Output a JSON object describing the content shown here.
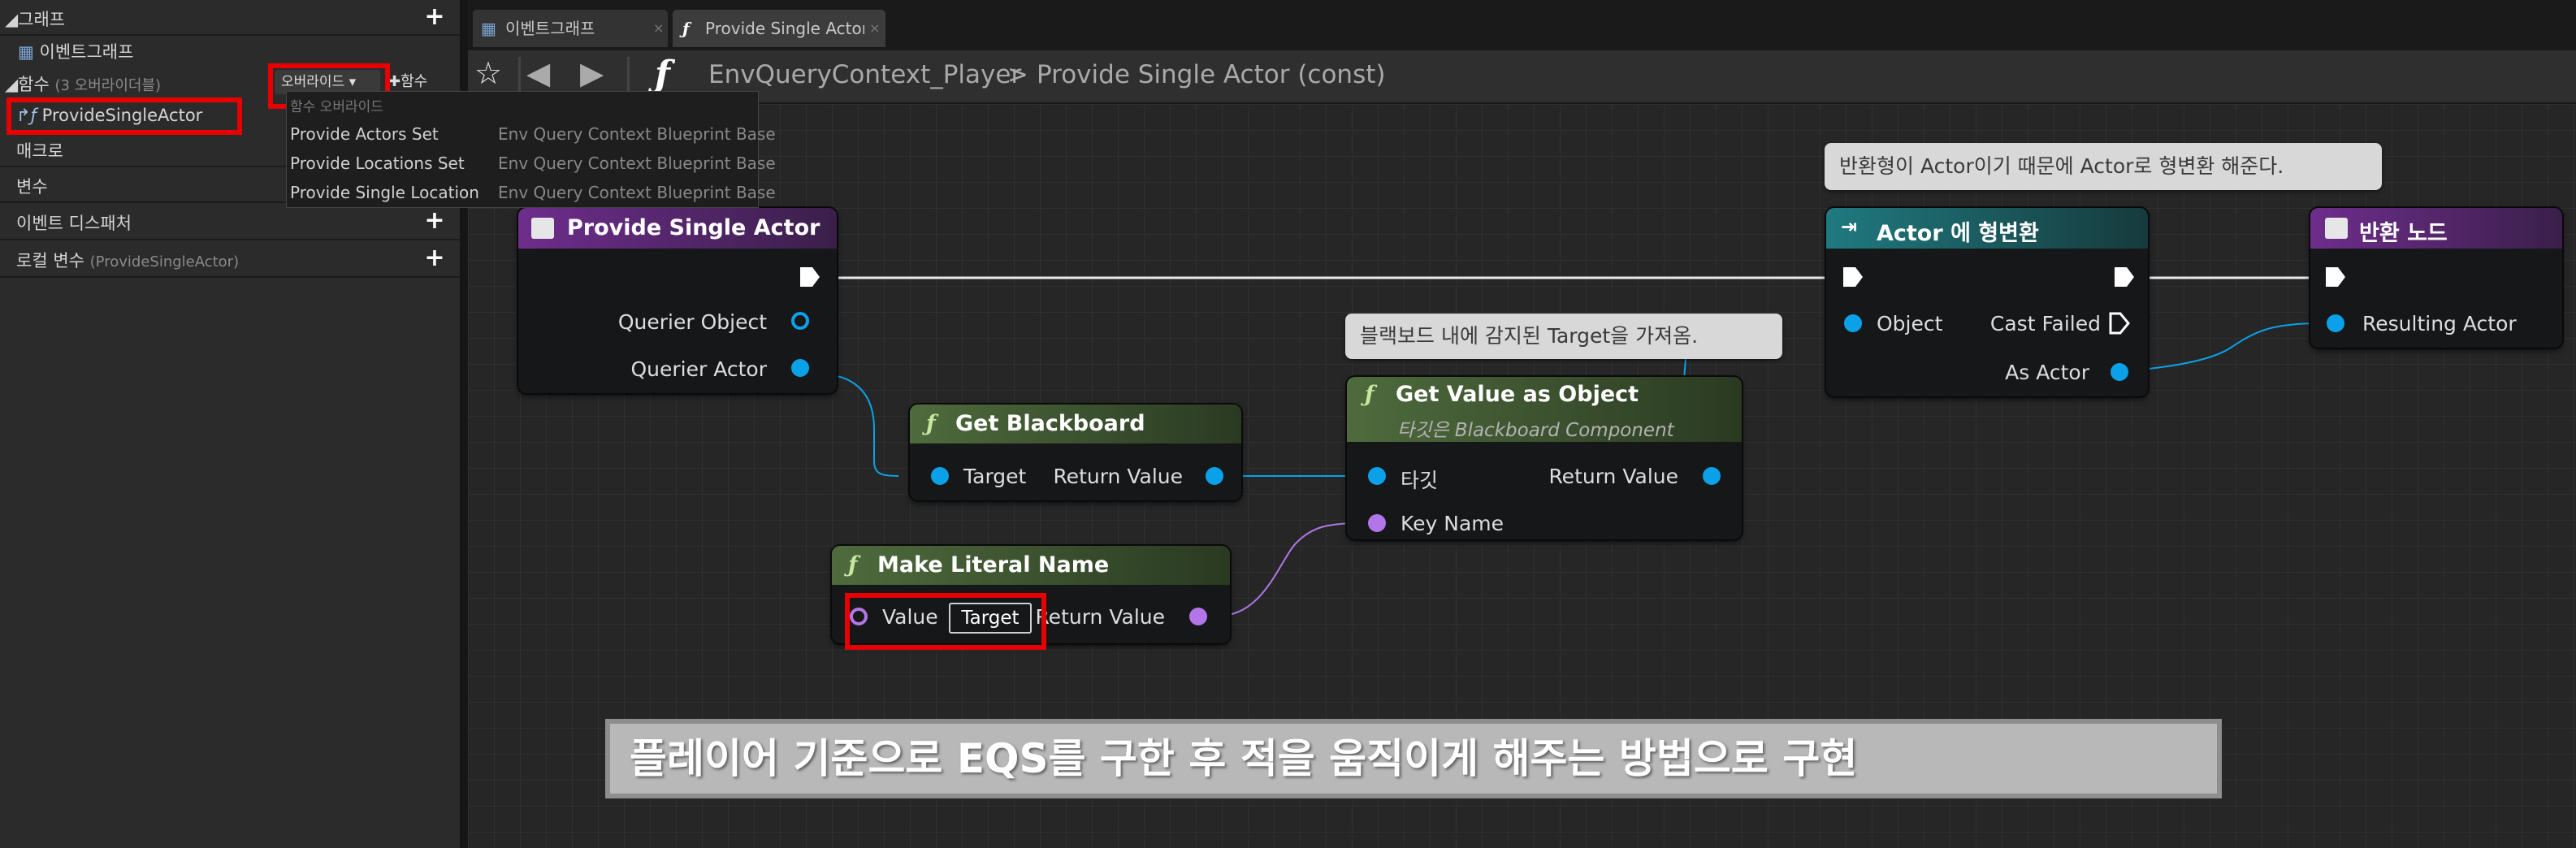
{
  "panel": {
    "graph_label": "그래프",
    "event_graph": "이벤트그래프",
    "functions_label": "함수",
    "functions_sub": "(3 오버라이더블)",
    "override_button": "오버라이드",
    "add_function_button": "함수",
    "function_item": "ProvideSingleActor",
    "macros_label": "매크로",
    "variables_label": "변수",
    "dispatchers_label": "이벤트 디스패처",
    "local_vars_label": "로컬 변수",
    "local_vars_sub": "(ProvideSingleActor)"
  },
  "override_menu": {
    "header": "함수 오버라이드",
    "items": [
      {
        "name": "Provide Actors Set",
        "source": "Env Query Context Blueprint Base"
      },
      {
        "name": "Provide Locations Set",
        "source": "Env Query Context Blueprint Base"
      },
      {
        "name": "Provide Single Location",
        "source": "Env Query Context Blueprint Base"
      }
    ]
  },
  "tabs": [
    {
      "label": "이벤트그래프"
    },
    {
      "label": "Provide Single Actor"
    }
  ],
  "breadcrumb": {
    "part1": "EnvQueryContext_Player",
    "separator": ">",
    "part2": "Provide Single Actor (const)"
  },
  "nodes": {
    "entry": {
      "title": "Provide Single Actor",
      "pin1": "Querier Object",
      "pin2": "Querier Actor"
    },
    "get_blackboard": {
      "title": "Get Blackboard",
      "in": "Target",
      "out": "Return Value"
    },
    "make_literal": {
      "title": "Make Literal Name",
      "in": "Value",
      "literal": "Target",
      "out": "Return Value"
    },
    "get_value": {
      "title": "Get Value as Object",
      "subtitle": "타깃은 Blackboard Component",
      "in1": "타깃",
      "in2": "Key Name",
      "out": "Return Value"
    },
    "cast": {
      "title": "Actor 에 형변환",
      "in": "Object",
      "failed": "Cast Failed",
      "out": "As Actor"
    },
    "return": {
      "title": "반환 노드",
      "in": "Resulting Actor"
    }
  },
  "comments": {
    "blackboard": "블랙보드 내에 감지된 Target을 가져옴.",
    "cast": "반환형이 Actor이기 때문에 Actor로 형변환 해준다."
  },
  "banner": "플레이어 기준으로 EQS를 구한 후 적을 움직이게 해주는 방법으로 구현",
  "colors": {
    "entry_header": "#5a2a7a",
    "function_header": "#4f6b3d",
    "cast_header": "#1e6d73",
    "highlight": "#e60000",
    "object_pin": "#0aa1e8",
    "name_pin": "#b276e8"
  }
}
